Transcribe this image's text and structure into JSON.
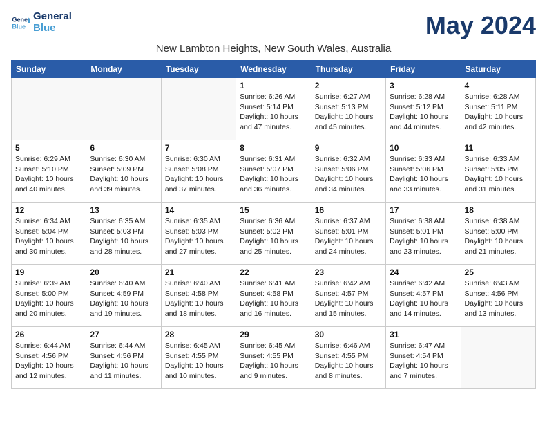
{
  "header": {
    "logo_line1": "General",
    "logo_line2": "Blue",
    "month_title": "May 2024",
    "location": "New Lambton Heights, New South Wales, Australia"
  },
  "weekdays": [
    "Sunday",
    "Monday",
    "Tuesday",
    "Wednesday",
    "Thursday",
    "Friday",
    "Saturday"
  ],
  "weeks": [
    [
      {
        "day": "",
        "info": ""
      },
      {
        "day": "",
        "info": ""
      },
      {
        "day": "",
        "info": ""
      },
      {
        "day": "1",
        "info": "Sunrise: 6:26 AM\nSunset: 5:14 PM\nDaylight: 10 hours\nand 47 minutes."
      },
      {
        "day": "2",
        "info": "Sunrise: 6:27 AM\nSunset: 5:13 PM\nDaylight: 10 hours\nand 45 minutes."
      },
      {
        "day": "3",
        "info": "Sunrise: 6:28 AM\nSunset: 5:12 PM\nDaylight: 10 hours\nand 44 minutes."
      },
      {
        "day": "4",
        "info": "Sunrise: 6:28 AM\nSunset: 5:11 PM\nDaylight: 10 hours\nand 42 minutes."
      }
    ],
    [
      {
        "day": "5",
        "info": "Sunrise: 6:29 AM\nSunset: 5:10 PM\nDaylight: 10 hours\nand 40 minutes."
      },
      {
        "day": "6",
        "info": "Sunrise: 6:30 AM\nSunset: 5:09 PM\nDaylight: 10 hours\nand 39 minutes."
      },
      {
        "day": "7",
        "info": "Sunrise: 6:30 AM\nSunset: 5:08 PM\nDaylight: 10 hours\nand 37 minutes."
      },
      {
        "day": "8",
        "info": "Sunrise: 6:31 AM\nSunset: 5:07 PM\nDaylight: 10 hours\nand 36 minutes."
      },
      {
        "day": "9",
        "info": "Sunrise: 6:32 AM\nSunset: 5:06 PM\nDaylight: 10 hours\nand 34 minutes."
      },
      {
        "day": "10",
        "info": "Sunrise: 6:33 AM\nSunset: 5:06 PM\nDaylight: 10 hours\nand 33 minutes."
      },
      {
        "day": "11",
        "info": "Sunrise: 6:33 AM\nSunset: 5:05 PM\nDaylight: 10 hours\nand 31 minutes."
      }
    ],
    [
      {
        "day": "12",
        "info": "Sunrise: 6:34 AM\nSunset: 5:04 PM\nDaylight: 10 hours\nand 30 minutes."
      },
      {
        "day": "13",
        "info": "Sunrise: 6:35 AM\nSunset: 5:03 PM\nDaylight: 10 hours\nand 28 minutes."
      },
      {
        "day": "14",
        "info": "Sunrise: 6:35 AM\nSunset: 5:03 PM\nDaylight: 10 hours\nand 27 minutes."
      },
      {
        "day": "15",
        "info": "Sunrise: 6:36 AM\nSunset: 5:02 PM\nDaylight: 10 hours\nand 25 minutes."
      },
      {
        "day": "16",
        "info": "Sunrise: 6:37 AM\nSunset: 5:01 PM\nDaylight: 10 hours\nand 24 minutes."
      },
      {
        "day": "17",
        "info": "Sunrise: 6:38 AM\nSunset: 5:01 PM\nDaylight: 10 hours\nand 23 minutes."
      },
      {
        "day": "18",
        "info": "Sunrise: 6:38 AM\nSunset: 5:00 PM\nDaylight: 10 hours\nand 21 minutes."
      }
    ],
    [
      {
        "day": "19",
        "info": "Sunrise: 6:39 AM\nSunset: 5:00 PM\nDaylight: 10 hours\nand 20 minutes."
      },
      {
        "day": "20",
        "info": "Sunrise: 6:40 AM\nSunset: 4:59 PM\nDaylight: 10 hours\nand 19 minutes."
      },
      {
        "day": "21",
        "info": "Sunrise: 6:40 AM\nSunset: 4:58 PM\nDaylight: 10 hours\nand 18 minutes."
      },
      {
        "day": "22",
        "info": "Sunrise: 6:41 AM\nSunset: 4:58 PM\nDaylight: 10 hours\nand 16 minutes."
      },
      {
        "day": "23",
        "info": "Sunrise: 6:42 AM\nSunset: 4:57 PM\nDaylight: 10 hours\nand 15 minutes."
      },
      {
        "day": "24",
        "info": "Sunrise: 6:42 AM\nSunset: 4:57 PM\nDaylight: 10 hours\nand 14 minutes."
      },
      {
        "day": "25",
        "info": "Sunrise: 6:43 AM\nSunset: 4:56 PM\nDaylight: 10 hours\nand 13 minutes."
      }
    ],
    [
      {
        "day": "26",
        "info": "Sunrise: 6:44 AM\nSunset: 4:56 PM\nDaylight: 10 hours\nand 12 minutes."
      },
      {
        "day": "27",
        "info": "Sunrise: 6:44 AM\nSunset: 4:56 PM\nDaylight: 10 hours\nand 11 minutes."
      },
      {
        "day": "28",
        "info": "Sunrise: 6:45 AM\nSunset: 4:55 PM\nDaylight: 10 hours\nand 10 minutes."
      },
      {
        "day": "29",
        "info": "Sunrise: 6:45 AM\nSunset: 4:55 PM\nDaylight: 10 hours\nand 9 minutes."
      },
      {
        "day": "30",
        "info": "Sunrise: 6:46 AM\nSunset: 4:55 PM\nDaylight: 10 hours\nand 8 minutes."
      },
      {
        "day": "31",
        "info": "Sunrise: 6:47 AM\nSunset: 4:54 PM\nDaylight: 10 hours\nand 7 minutes."
      },
      {
        "day": "",
        "info": ""
      }
    ]
  ]
}
